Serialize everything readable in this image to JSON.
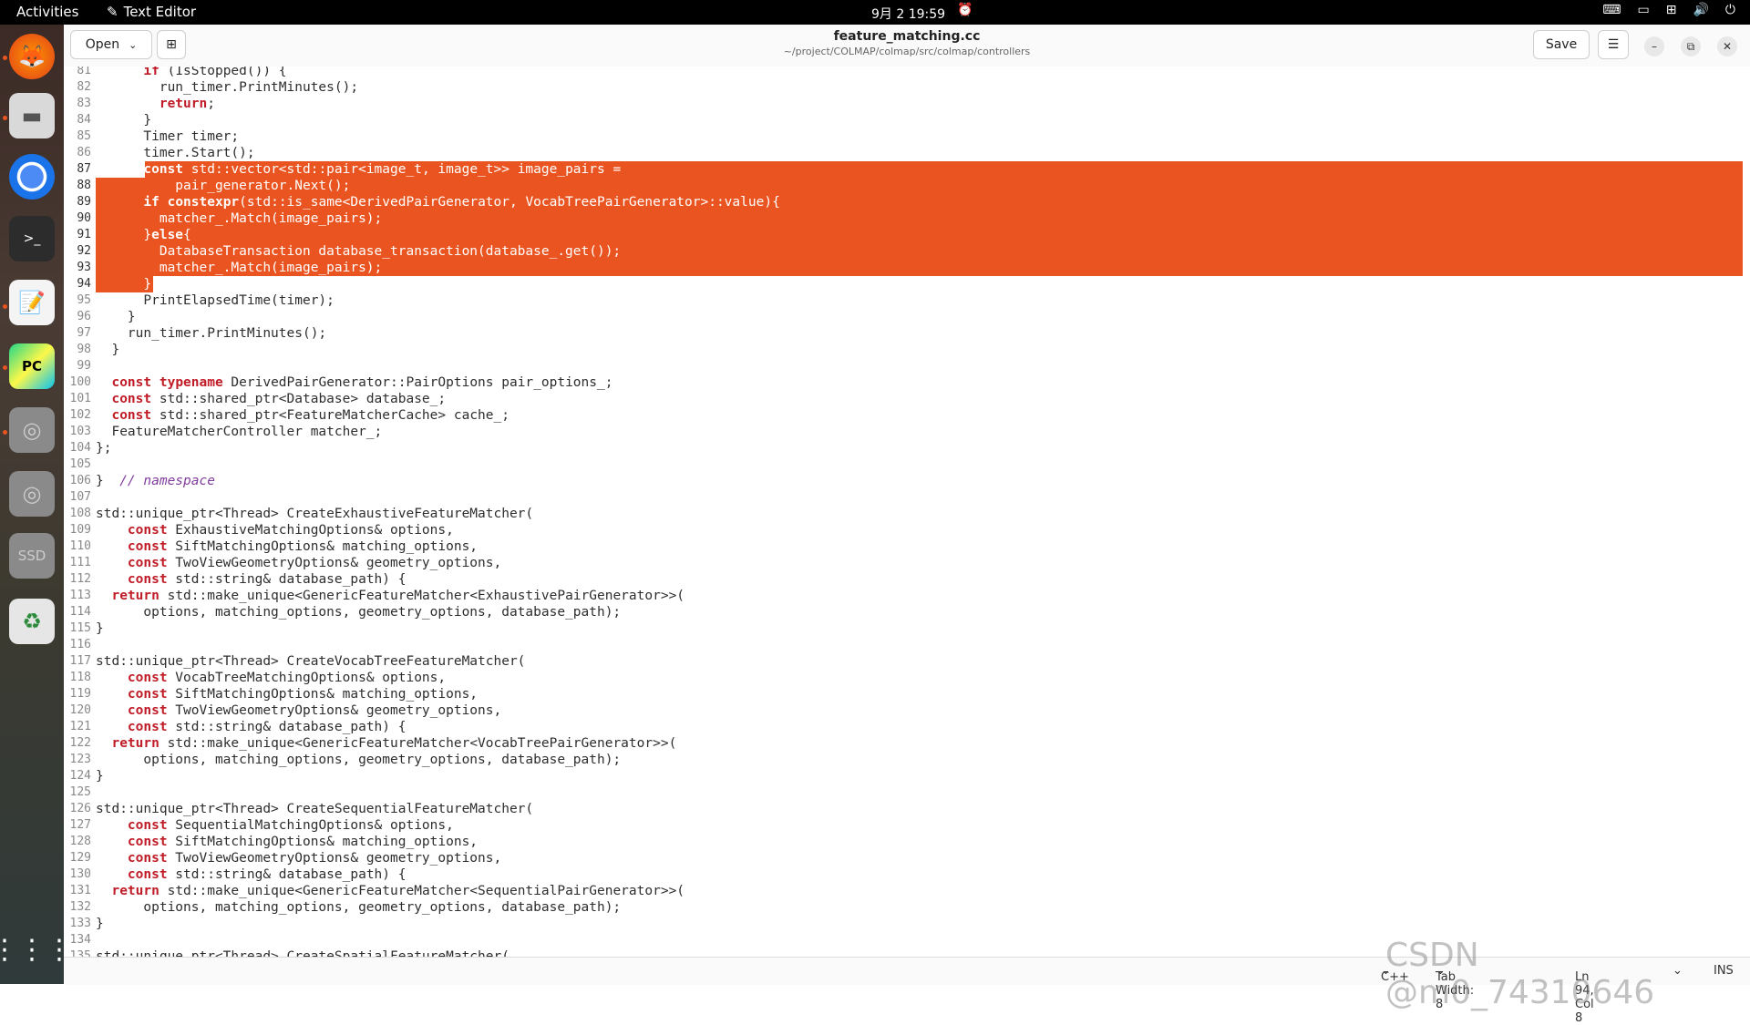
{
  "topbar": {
    "activities": "Activities",
    "app_name": "Text Editor",
    "clock": "9月 2  19:59"
  },
  "header": {
    "open_label": "Open",
    "title": "feature_matching.cc",
    "subtitle": "~/project/COLMAP/colmap/src/colmap/controllers",
    "save_label": "Save"
  },
  "editor": {
    "lines": [
      {
        "n": "81",
        "t": "      if (IsStopped()) {"
      },
      {
        "n": "82",
        "t": "        run_timer.PrintMinutes();"
      },
      {
        "n": "83",
        "t": "        return;"
      },
      {
        "n": "84",
        "t": "      }"
      },
      {
        "n": "85",
        "t": "      Timer timer;"
      },
      {
        "n": "86",
        "t": "      timer.Start();"
      },
      {
        "n": "87",
        "t": "      const std::vector<std::pair<image_t, image_t>> image_pairs ="
      },
      {
        "n": "88",
        "t": "          pair_generator.Next();"
      },
      {
        "n": "89",
        "t": "      if constexpr(std::is_same<DerivedPairGenerator, VocabTreePairGenerator>::value){"
      },
      {
        "n": "90",
        "t": "        matcher_.Match(image_pairs);"
      },
      {
        "n": "91",
        "t": "      }else{"
      },
      {
        "n": "92",
        "t": "        DatabaseTransaction database_transaction(database_.get());"
      },
      {
        "n": "93",
        "t": "        matcher_.Match(image_pairs);"
      },
      {
        "n": "94",
        "t": "      }"
      },
      {
        "n": "95",
        "t": "      PrintElapsedTime(timer);"
      },
      {
        "n": "96",
        "t": "    }"
      },
      {
        "n": "97",
        "t": "    run_timer.PrintMinutes();"
      },
      {
        "n": "98",
        "t": "  }"
      },
      {
        "n": "99",
        "t": ""
      },
      {
        "n": "100",
        "t": "  const typename DerivedPairGenerator::PairOptions pair_options_;"
      },
      {
        "n": "101",
        "t": "  const std::shared_ptr<Database> database_;"
      },
      {
        "n": "102",
        "t": "  const std::shared_ptr<FeatureMatcherCache> cache_;"
      },
      {
        "n": "103",
        "t": "  FeatureMatcherController matcher_;"
      },
      {
        "n": "104",
        "t": "};"
      },
      {
        "n": "105",
        "t": ""
      },
      {
        "n": "106",
        "t": "}  // namespace"
      },
      {
        "n": "107",
        "t": ""
      },
      {
        "n": "108",
        "t": "std::unique_ptr<Thread> CreateExhaustiveFeatureMatcher("
      },
      {
        "n": "109",
        "t": "    const ExhaustiveMatchingOptions& options,"
      },
      {
        "n": "110",
        "t": "    const SiftMatchingOptions& matching_options,"
      },
      {
        "n": "111",
        "t": "    const TwoViewGeometryOptions& geometry_options,"
      },
      {
        "n": "112",
        "t": "    const std::string& database_path) {"
      },
      {
        "n": "113",
        "t": "  return std::make_unique<GenericFeatureMatcher<ExhaustivePairGenerator>>("
      },
      {
        "n": "114",
        "t": "      options, matching_options, geometry_options, database_path);"
      },
      {
        "n": "115",
        "t": "}"
      },
      {
        "n": "116",
        "t": ""
      },
      {
        "n": "117",
        "t": "std::unique_ptr<Thread> CreateVocabTreeFeatureMatcher("
      },
      {
        "n": "118",
        "t": "    const VocabTreeMatchingOptions& options,"
      },
      {
        "n": "119",
        "t": "    const SiftMatchingOptions& matching_options,"
      },
      {
        "n": "120",
        "t": "    const TwoViewGeometryOptions& geometry_options,"
      },
      {
        "n": "121",
        "t": "    const std::string& database_path) {"
      },
      {
        "n": "122",
        "t": "  return std::make_unique<GenericFeatureMatcher<VocabTreePairGenerator>>("
      },
      {
        "n": "123",
        "t": "      options, matching_options, geometry_options, database_path);"
      },
      {
        "n": "124",
        "t": "}"
      },
      {
        "n": "125",
        "t": ""
      },
      {
        "n": "126",
        "t": "std::unique_ptr<Thread> CreateSequentialFeatureMatcher("
      },
      {
        "n": "127",
        "t": "    const SequentialMatchingOptions& options,"
      },
      {
        "n": "128",
        "t": "    const SiftMatchingOptions& matching_options,"
      },
      {
        "n": "129",
        "t": "    const TwoViewGeometryOptions& geometry_options,"
      },
      {
        "n": "130",
        "t": "    const std::string& database_path) {"
      },
      {
        "n": "131",
        "t": "  return std::make_unique<GenericFeatureMatcher<SequentialPairGenerator>>("
      },
      {
        "n": "132",
        "t": "      options, matching_options, geometry_options, database_path);"
      },
      {
        "n": "133",
        "t": "}"
      },
      {
        "n": "134",
        "t": ""
      },
      {
        "n": "135",
        "t": "std::unique_ptr<Thread> CreateSpatialFeatureMatcher("
      }
    ],
    "selected_from": "87",
    "selected_to": "94"
  },
  "statusbar": {
    "language": "C++",
    "tab_width": "Tab Width: 8",
    "cursor": "Ln 94, Col 8",
    "mode": "INS"
  },
  "watermark": "CSDN @m0_74310646",
  "colors": {
    "selection": "#e95420",
    "keyword": "#c01c28",
    "comment": "#813d9c"
  }
}
